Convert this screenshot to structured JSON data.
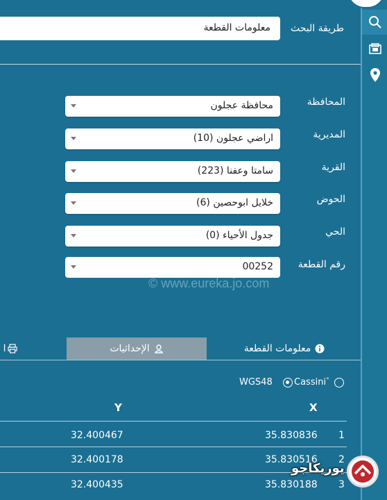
{
  "search": {
    "method_label": "طريقة البحث",
    "method_value": "معلومات القطعة"
  },
  "form": {
    "governorate": {
      "label": "المحافظة",
      "value": "محافظة عجلون"
    },
    "directorate": {
      "label": "المديرية",
      "value": "اراضي عجلون (10)"
    },
    "village": {
      "label": "القرية",
      "value": "سامتا وعفنا (223)"
    },
    "basin": {
      "label": "الحوض",
      "value": "خلايل ابوحصين (6)"
    },
    "neighborhood": {
      "label": "الحي",
      "value": "جدول الأحياء (0)"
    },
    "parcel": {
      "label": "رقم القطعة",
      "value": "00252"
    }
  },
  "watermark": "© www.eureka.jo.com",
  "tabs": {
    "info": "معلومات القطعة",
    "coords": "الإحداثيات",
    "print": "ا"
  },
  "coord_system": {
    "wgs": "WGS48",
    "cassini": "Cassini",
    "cassini_mark": "°"
  },
  "table": {
    "headers": {
      "x": "X",
      "y": "Y"
    },
    "rows": [
      {
        "n": "1",
        "x": "35.830836",
        "y": "32.400467"
      },
      {
        "n": "2",
        "x": "35.830516",
        "y": "32.400178"
      },
      {
        "n": "3",
        "x": "35.830188",
        "y": "32.400435"
      }
    ]
  },
  "brand": {
    "logo_text": "يوريكاجو"
  },
  "colors": {
    "panel": "#1b6f92",
    "tab_active": "#8a9ea9",
    "logo_red": "#c0272d"
  }
}
